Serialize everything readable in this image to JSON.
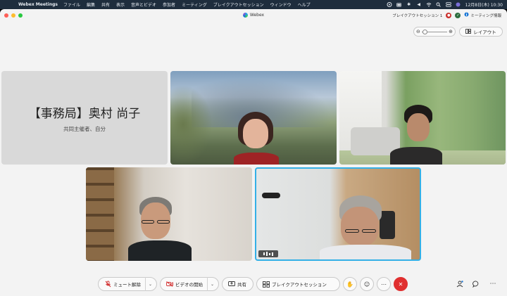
{
  "menubar": {
    "app_name": "Webex Meetings",
    "items": [
      "ファイル",
      "編集",
      "共有",
      "表示",
      "音声とビデオ",
      "参加者",
      "ミーティング",
      "ブレイクアウトセッション",
      "ウィンドウ",
      "ヘルプ"
    ],
    "clock": "12月8日(木) 10:30"
  },
  "window": {
    "title": "Webex",
    "session_label": "ブレイクアウトセッション 1",
    "meeting_info_label": "ミーティング情報"
  },
  "view_controls": {
    "layout_label": "レイアウト",
    "zoom_level": 0.1
  },
  "participants": [
    {
      "name": "【事務局】奥村 尚子",
      "role": "共同主催者、自分",
      "video": false
    },
    {
      "video": true
    },
    {
      "video": true
    },
    {
      "video": true
    },
    {
      "video": true,
      "active_speaker": true
    }
  ],
  "controls": {
    "mute_label": "ミュート解除",
    "video_label": "ビデオの開始",
    "share_label": "共有",
    "breakout_label": "ブレイクアウトセッション"
  },
  "colors": {
    "menubar_bg": "#1e2d3d",
    "active_speaker_border": "#34b0e6",
    "end_call": "#e02f2f",
    "mute_icon": "#d22f2f"
  }
}
